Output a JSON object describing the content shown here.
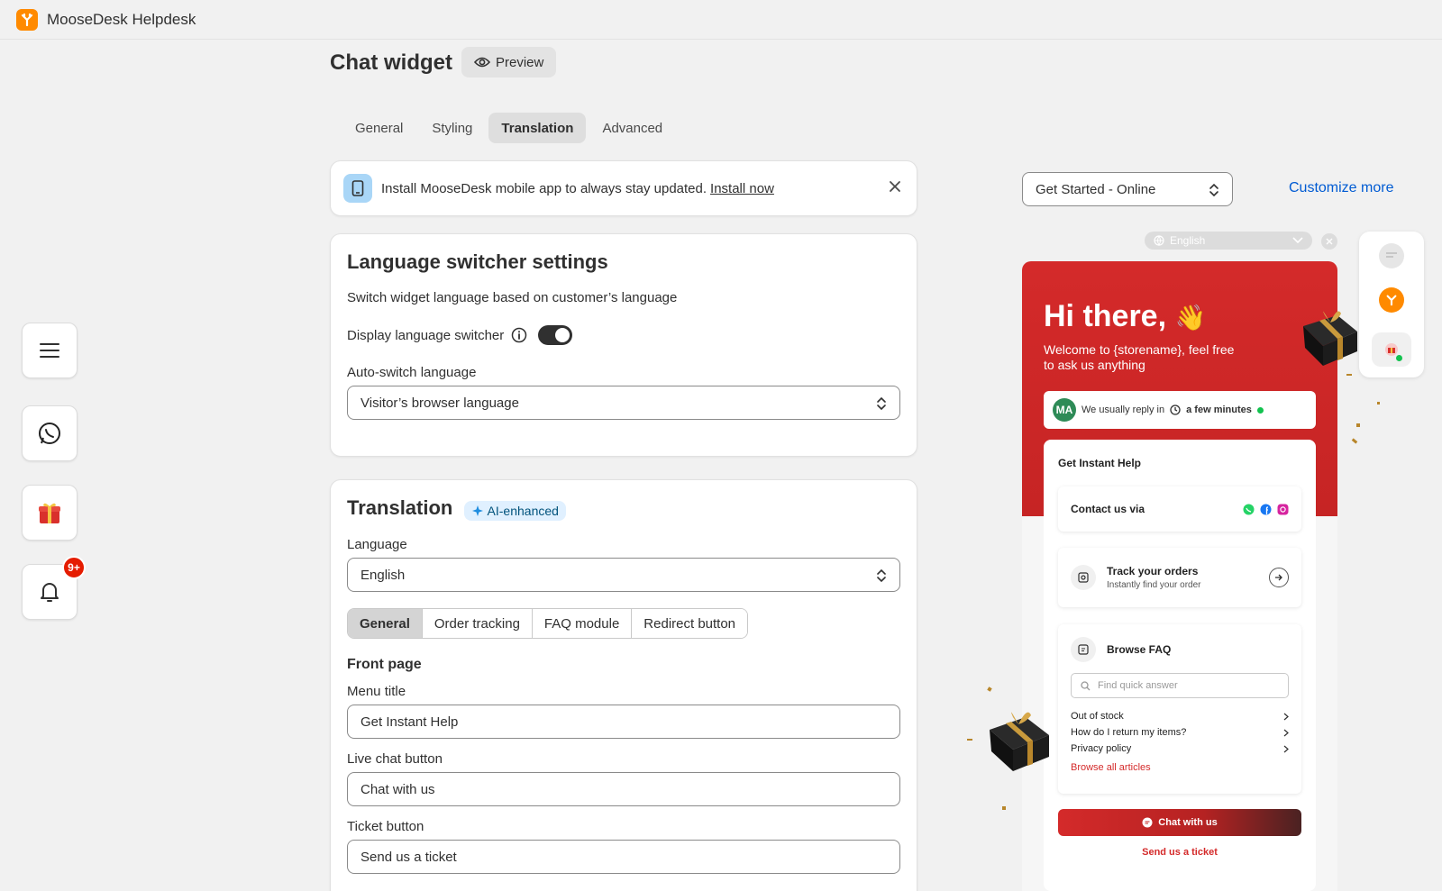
{
  "app": {
    "name": "MooseDesk Helpdesk"
  },
  "header": {
    "title": "Chat widget",
    "preview_label": "Preview"
  },
  "tabs": [
    {
      "label": "General",
      "active": false
    },
    {
      "label": "Styling",
      "active": false
    },
    {
      "label": "Translation",
      "active": true
    },
    {
      "label": "Advanced",
      "active": false
    }
  ],
  "banner": {
    "text": "Install MooseDesk mobile app to always stay updated.",
    "link": "Install now"
  },
  "language_switcher": {
    "title": "Language switcher settings",
    "description": "Switch widget language based on customer’s language",
    "display_label": "Display language switcher",
    "display_enabled": true,
    "auto_switch_label": "Auto-switch language",
    "auto_switch_value": "Visitor’s browser language"
  },
  "translation": {
    "title": "Translation",
    "badge": "AI-enhanced",
    "language_label": "Language",
    "language_value": "English",
    "segments": [
      {
        "label": "General",
        "active": true
      },
      {
        "label": "Order tracking",
        "active": false
      },
      {
        "label": "FAQ module",
        "active": false
      },
      {
        "label": "Redirect button",
        "active": false
      }
    ],
    "section_title": "Front page",
    "menu_title_label": "Menu title",
    "menu_title_value": "Get Instant Help",
    "live_chat_label": "Live chat button",
    "live_chat_value": "Chat with us",
    "ticket_label": "Ticket button",
    "ticket_value": "Send us a ticket"
  },
  "floating": {
    "notif_badge": "9+"
  },
  "preview_panel": {
    "view_select": "Get Started - Online",
    "customize_link": "Customize more",
    "lang_pill": "English",
    "widget": {
      "hero_title": "Hi there,",
      "hero_sub": "Welcome to {storename}, feel free to ask us anything",
      "avatar_initials": "MA",
      "reply_text": "We usually reply in",
      "reply_time": "a few minutes",
      "panel_title": "Get Instant Help",
      "contact_label": "Contact us via",
      "track_title": "Track your orders",
      "track_sub": "Instantly find your order",
      "faq_title": "Browse FAQ",
      "faq_placeholder": "Find quick answer",
      "faq_items": [
        "Out of stock",
        "How do I return my items?",
        "Privacy policy"
      ],
      "faq_browse": "Browse all articles",
      "chat_button": "Chat with us",
      "ticket_link": "Send us a ticket"
    }
  },
  "colors": {
    "accent": "#005bd3",
    "brand": "#ff8a00",
    "widget_red": "#d42a2a"
  }
}
